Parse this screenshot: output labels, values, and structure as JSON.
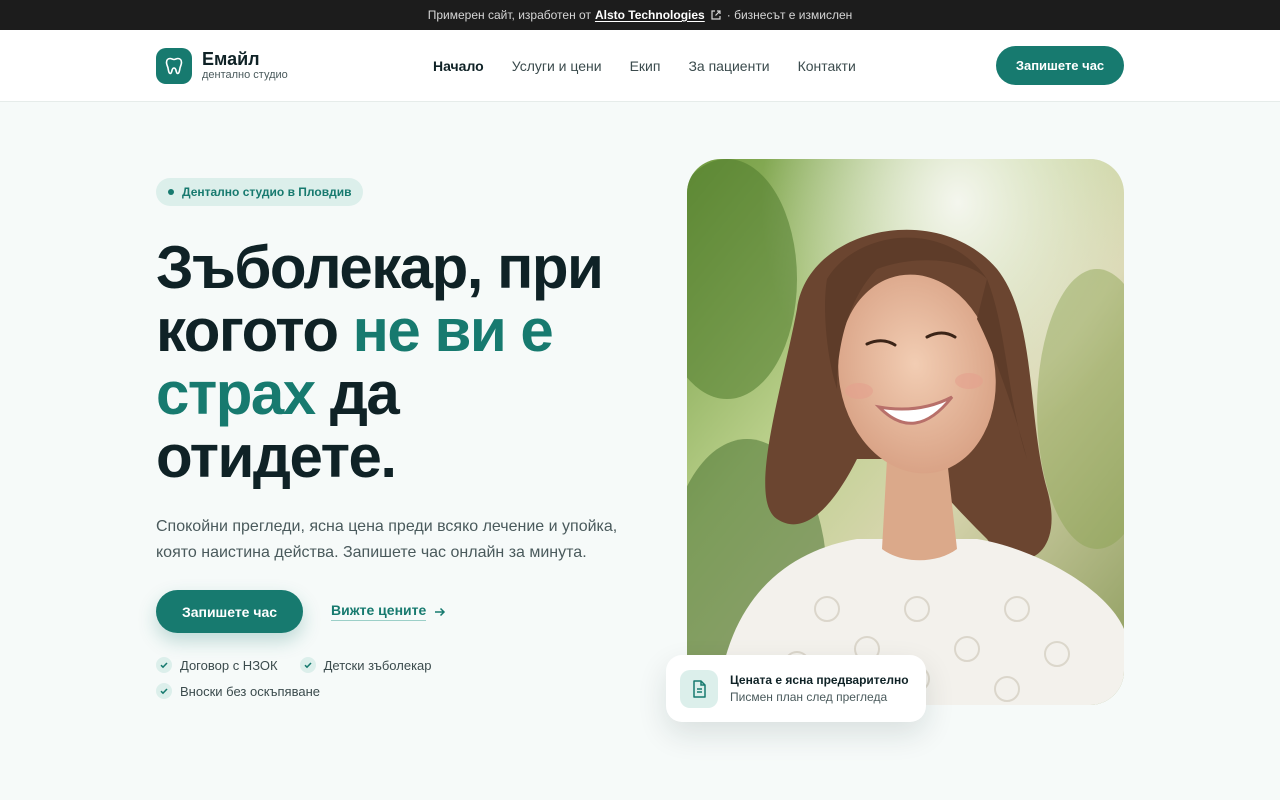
{
  "topbar": {
    "prefix": "Примерен сайт, изработен от",
    "company": "Alsto Technologies",
    "suffix": "· бизнесът е измислен"
  },
  "brand": {
    "name": "Емайл",
    "tagline": "дентално студио"
  },
  "nav": {
    "items": [
      "Начало",
      "Услуги и цени",
      "Екип",
      "За пациенти",
      "Контакти"
    ],
    "active": "Начало",
    "cta": "Запишете час"
  },
  "hero": {
    "badge": "Дентално студио в Пловдив",
    "headline": {
      "line1": "Зъболекар, при",
      "part2": "когото ",
      "highlight1": "не ви е",
      "highlight2": "страх",
      "part3": " да",
      "line4": "отидете."
    },
    "lead": "Спокойни прегледи, ясна цена преди всяко лечение и упойка, която наистина действа. Запишете час онлайн за минута.",
    "primary_cta": "Запишете час",
    "secondary_cta": "Вижте цените",
    "features": [
      "Договор с НЗОК",
      "Детски зъболекар",
      "Вноски без оскъпяване"
    ]
  },
  "card": {
    "title": "Цената е ясна предварително",
    "subtitle": "Писмен план след прегледа"
  },
  "colors": {
    "accent": "#177a6f",
    "accent_soft": "#dcefeb",
    "dark": "#0f2226",
    "topbar": "#1c1c1c"
  },
  "icons": {
    "logo": "tooth-icon",
    "external": "external-link-icon",
    "arrow": "arrow-right-icon",
    "check": "check-icon",
    "document": "document-icon"
  }
}
